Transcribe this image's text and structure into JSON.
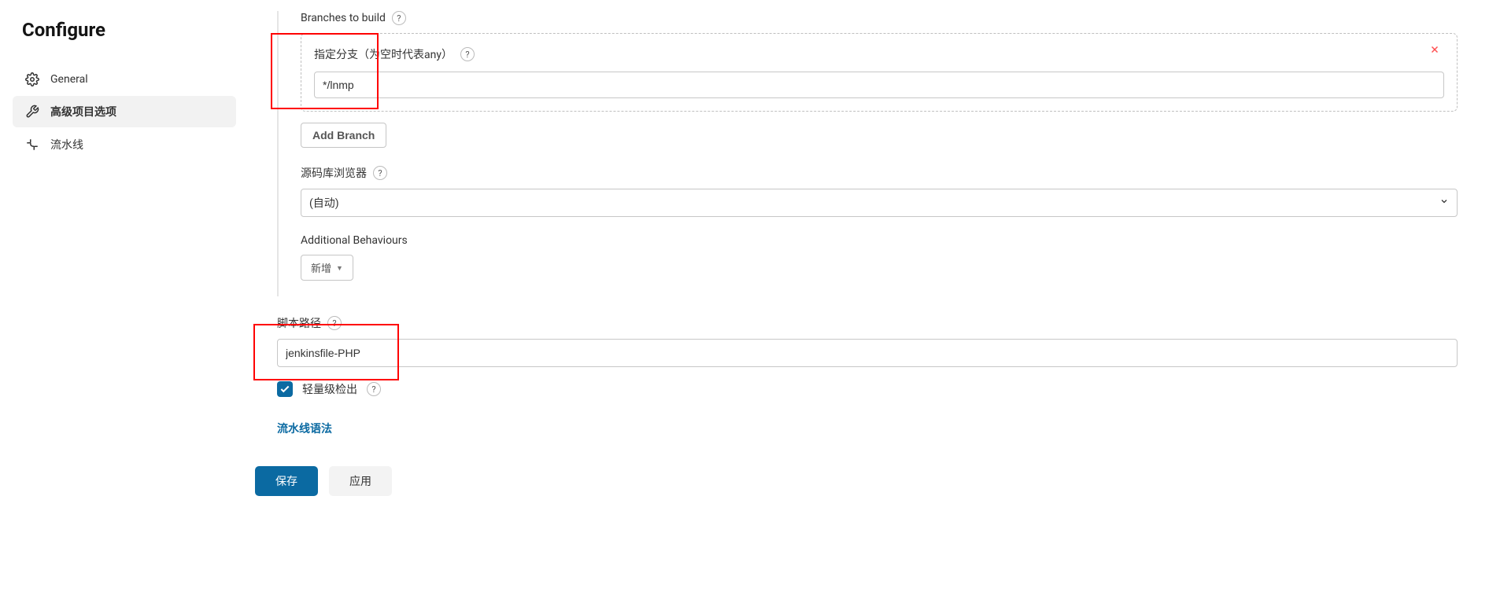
{
  "sidebar": {
    "title": "Configure",
    "items": [
      {
        "label": "General"
      },
      {
        "label": "高级项目选项"
      },
      {
        "label": "流水线"
      }
    ]
  },
  "main": {
    "branches_label": "Branches to build",
    "branch_spec_label": "指定分支（为空时代表any）",
    "branch_spec_value": "*/lnmp",
    "add_branch_label": "Add Branch",
    "repo_browser_label": "源码库浏览器",
    "repo_browser_value": "(自动)",
    "additional_behaviours_label": "Additional Behaviours",
    "add_dropdown_label": "新增",
    "script_path_label": "脚本路径",
    "script_path_value": "jenkinsfile-PHP",
    "lightweight_checkout_label": "轻量级检出",
    "pipeline_syntax_label": "流水线语法",
    "save_label": "保存",
    "apply_label": "应用"
  }
}
